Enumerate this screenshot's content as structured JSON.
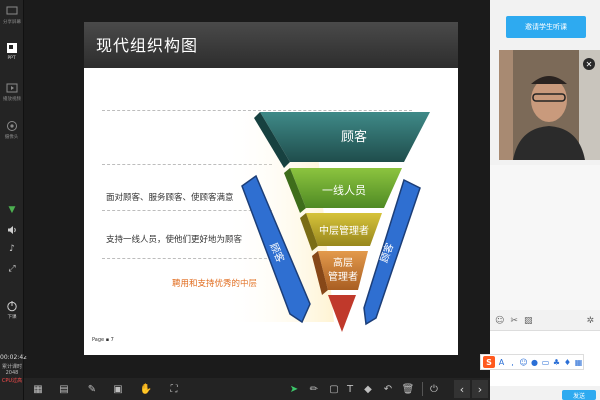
{
  "left_bar": {
    "items": [
      {
        "label": "分享屏幕",
        "icon": "screen-share-icon"
      },
      {
        "label": "PPT",
        "icon": "ppt-icon"
      },
      {
        "label": "播放视频",
        "icon": "play-video-icon"
      },
      {
        "label": "摄像头",
        "icon": "camera-icon"
      }
    ],
    "leave_label": "下课",
    "time": "00:02:42",
    "elapsed_label": "累计课时",
    "elapsed_value": "2048",
    "cpu_label": "CPU过高"
  },
  "slide": {
    "title": "现代组织构图",
    "notes": [
      "面对顾客、服务顾客、使顾客满意",
      "支持一线人员，使他们更好地为顾客",
      "聘用和支持优秀的中层"
    ],
    "levels": [
      "顾客",
      "一线人员",
      "中层管理者",
      "高层",
      "管理者"
    ],
    "side_left": "顾客",
    "side_right": "顾客",
    "page": "Page ▪ 7"
  },
  "right_panel": {
    "invite_button": "邀请学生听课",
    "send_button": "发送"
  },
  "colors": {
    "accent": "#2eaaf0",
    "level1": "#2e6b6a",
    "level2": "#6aa52f",
    "level3": "#b7a325",
    "level4": "#c97a33",
    "tip": "#c0392b",
    "side_arrow": "#2f6fd1"
  }
}
